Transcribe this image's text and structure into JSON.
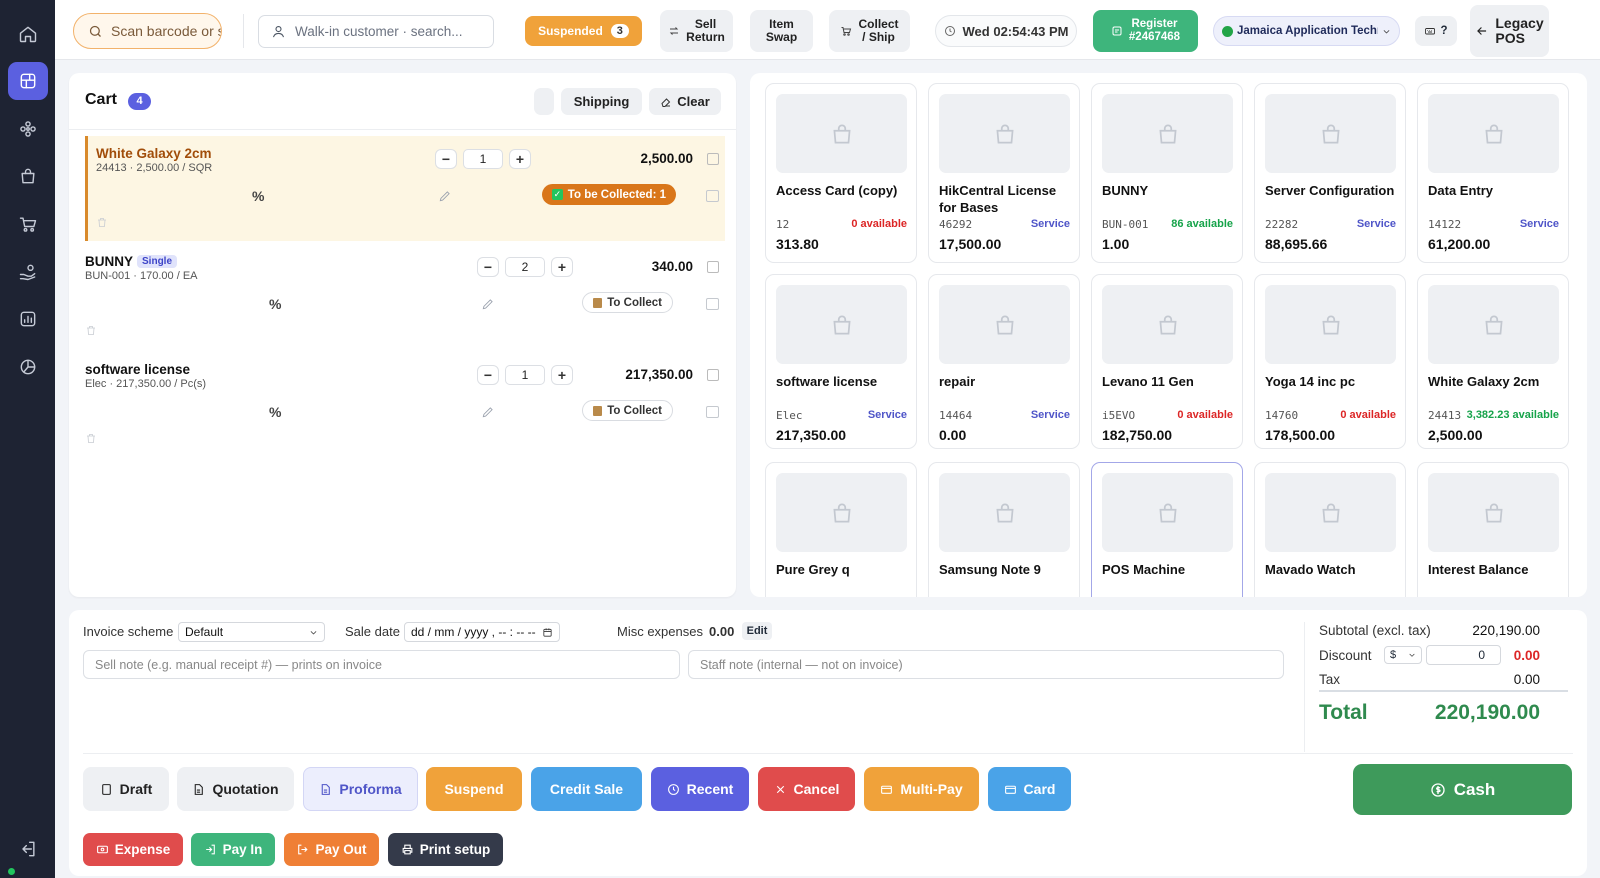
{
  "colors": {
    "accent": "#5b60e0",
    "sidebar": "#1e2333",
    "success": "#3e9a5b",
    "warning": "#f0a23a",
    "danger": "#e04c4c",
    "info": "#4aa3e8"
  },
  "sidebar": {
    "items": [
      "home-icon",
      "pos-icon",
      "products-icon",
      "bag-icon",
      "cart-icon",
      "hand-coins-icon",
      "reports-icon",
      "chart-icon"
    ],
    "active_index": 1
  },
  "topbar": {
    "barcode_placeholder": "Scan barcode or search...",
    "customer_placeholder": "Walk-in customer · search...",
    "suspended_label": "Suspended",
    "suspended_count": "3",
    "sell_return": "Sell\nReturn",
    "item_swap": "Item\nSwap",
    "collect_ship": "Collect\n/ Ship",
    "clock": "Wed 02:54:43 PM",
    "register_label": "Register",
    "register_number": "#2467468",
    "location": "Jamaica Application Technology",
    "help": "?",
    "legacy_pos": "Legacy\nPOS"
  },
  "cart": {
    "title": "Cart",
    "count": "4",
    "shipping": "Shipping",
    "clear": "Clear",
    "percent_symbol": "%",
    "lines": [
      {
        "name": "White Galaxy 2cm",
        "badge": "",
        "sub": "24413 · 2,500.00 / SQR",
        "qty": "1",
        "price": "2,500.00",
        "collect": "To be Collected: 1"
      },
      {
        "name": "BUNNY",
        "badge": "Single",
        "sub": "BUN-001 · 170.00 / EA",
        "qty": "2",
        "price": "340.00",
        "collect": "To Collect"
      },
      {
        "name": "software license",
        "badge": "",
        "sub": "Elec · 217,350.00 / Pc(s)",
        "qty": "1",
        "price": "217,350.00",
        "collect": "To Collect"
      }
    ]
  },
  "products": [
    {
      "name": "Access Card (copy)",
      "sku": "12",
      "status": "0 available",
      "status_type": "red",
      "price": "313.80"
    },
    {
      "name": "HikCentral License for Bases",
      "sku": "46292",
      "status": "Service",
      "status_type": "blue",
      "price": "17,500.00"
    },
    {
      "name": "BUNNY",
      "sku": "BUN-001",
      "status": "86 available",
      "status_type": "green",
      "price": "1.00"
    },
    {
      "name": "Server Configuration",
      "sku": "22282",
      "status": "Service",
      "status_type": "blue",
      "price": "88,695.66"
    },
    {
      "name": "Data Entry",
      "sku": "14122",
      "status": "Service",
      "status_type": "blue",
      "price": "61,200.00"
    },
    {
      "name": "software license",
      "sku": "Elec",
      "status": "Service",
      "status_type": "blue",
      "price": "217,350.00"
    },
    {
      "name": "repair",
      "sku": "14464",
      "status": "Service",
      "status_type": "blue",
      "price": "0.00"
    },
    {
      "name": "Levano 11 Gen",
      "sku": "i5EVO",
      "status": "0 available",
      "status_type": "red",
      "price": "182,750.00"
    },
    {
      "name": "Yoga 14 inc pc",
      "sku": "14760",
      "status": "0 available",
      "status_type": "red",
      "price": "178,500.00"
    },
    {
      "name": "White Galaxy 2cm",
      "sku": "24413",
      "status": "3,382.23 available",
      "status_type": "green",
      "price": "2,500.00"
    },
    {
      "name": "Pure Grey q",
      "sku": "",
      "status": "",
      "status_type": "",
      "price": ""
    },
    {
      "name": "Samsung Note 9",
      "sku": "",
      "status": "",
      "status_type": "",
      "price": ""
    },
    {
      "name": "POS Machine",
      "sku": "",
      "status": "",
      "status_type": "",
      "price": ""
    },
    {
      "name": "Mavado Watch",
      "sku": "",
      "status": "",
      "status_type": "",
      "price": ""
    },
    {
      "name": "Interest Balance",
      "sku": "",
      "status": "",
      "status_type": "",
      "price": ""
    }
  ],
  "footer": {
    "invoice_scheme_label": "Invoice scheme",
    "invoice_scheme_value": "Default",
    "sale_date_label": "Sale date",
    "sale_date_value": "dd / mm / yyyy ,  -- : --  --",
    "misc_label": "Misc expenses",
    "misc_value": "0.00",
    "misc_edit": "Edit",
    "sell_note_placeholder": "Sell note (e.g. manual receipt #) — prints on invoice",
    "staff_note_placeholder": "Staff note (internal — not on invoice)",
    "subtotal_label": "Subtotal (excl. tax)",
    "subtotal_value": "220,190.00",
    "discount_label": "Discount",
    "discount_type": "$",
    "discount_input": "0",
    "discount_value": "0.00",
    "tax_label": "Tax",
    "tax_value": "0.00",
    "total_label": "Total",
    "total_value": "220,190.00",
    "buttons": {
      "draft": "Draft",
      "quotation": "Quotation",
      "proforma": "Proforma",
      "suspend": "Suspend",
      "credit_sale": "Credit Sale",
      "recent": "Recent",
      "cancel": "Cancel",
      "multi_pay": "Multi-Pay",
      "card": "Card",
      "cash": "Cash",
      "expense": "Expense",
      "pay_in": "Pay In",
      "pay_out": "Pay Out",
      "print_setup": "Print setup"
    }
  }
}
